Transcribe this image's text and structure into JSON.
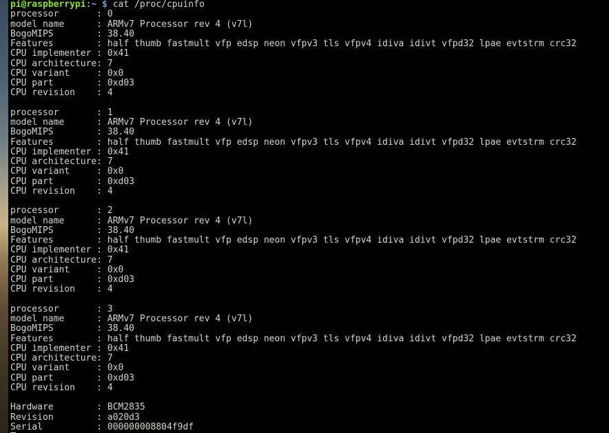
{
  "prompt": {
    "user_host": "pi@raspberrypi",
    "separator": ":",
    "path": "~",
    "dollar": " $ ",
    "command": "cat /proc/cpuinfo"
  },
  "lines": [
    "processor       : 0",
    "model name      : ARMv7 Processor rev 4 (v7l)",
    "BogoMIPS        : 38.40",
    "Features        : half thumb fastmult vfp edsp neon vfpv3 tls vfpv4 idiva idivt vfpd32 lpae evtstrm crc32",
    "CPU implementer : 0x41",
    "CPU architecture: 7",
    "CPU variant     : 0x0",
    "CPU part        : 0xd03",
    "CPU revision    : 4",
    "",
    "processor       : 1",
    "model name      : ARMv7 Processor rev 4 (v7l)",
    "BogoMIPS        : 38.40",
    "Features        : half thumb fastmult vfp edsp neon vfpv3 tls vfpv4 idiva idivt vfpd32 lpae evtstrm crc32",
    "CPU implementer : 0x41",
    "CPU architecture: 7",
    "CPU variant     : 0x0",
    "CPU part        : 0xd03",
    "CPU revision    : 4",
    "",
    "processor       : 2",
    "model name      : ARMv7 Processor rev 4 (v7l)",
    "BogoMIPS        : 38.40",
    "Features        : half thumb fastmult vfp edsp neon vfpv3 tls vfpv4 idiva idivt vfpd32 lpae evtstrm crc32",
    "CPU implementer : 0x41",
    "CPU architecture: 7",
    "CPU variant     : 0x0",
    "CPU part        : 0xd03",
    "CPU revision    : 4",
    "",
    "processor       : 3",
    "model name      : ARMv7 Processor rev 4 (v7l)",
    "BogoMIPS        : 38.40",
    "Features        : half thumb fastmult vfp edsp neon vfpv3 tls vfpv4 idiva idivt vfpd32 lpae evtstrm crc32",
    "CPU implementer : 0x41",
    "CPU architecture: 7",
    "CPU variant     : 0x0",
    "CPU part        : 0xd03",
    "CPU revision    : 4",
    "",
    "Hardware        : BCM2835",
    "Revision        : a020d3",
    "Serial          : 000000008804f9df"
  ],
  "colors": {
    "background": "#000000",
    "text": "#d3d7cf",
    "prompt_user": "#8ae234",
    "prompt_path": "#729fcf"
  }
}
